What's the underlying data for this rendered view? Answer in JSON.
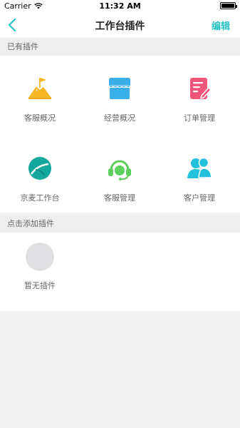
{
  "status": {
    "carrier": "Carrier",
    "time": "11:32 AM"
  },
  "nav": {
    "title": "工作台插件",
    "edit": "编辑"
  },
  "sections": {
    "existing": "已有插件",
    "add": "点击添加插件"
  },
  "plugins": [
    {
      "label": "客服概况",
      "icon": "flag-mountain-icon",
      "color": "#f5b623"
    },
    {
      "label": "经营概况",
      "icon": "storefront-icon",
      "color": "#39aee8"
    },
    {
      "label": "订单管理",
      "icon": "order-edit-icon",
      "color": "#f2557a"
    },
    {
      "label": "京麦工作台",
      "icon": "leaf-icon",
      "color": "#14a79d"
    },
    {
      "label": "客服管理",
      "icon": "headset-icon",
      "color": "#5ccf5c"
    },
    {
      "label": "客户管理",
      "icon": "users-icon",
      "color": "#23c1dc"
    }
  ],
  "empty": {
    "label": "暂无插件"
  },
  "colors": {
    "accent": "#26c2c6"
  }
}
